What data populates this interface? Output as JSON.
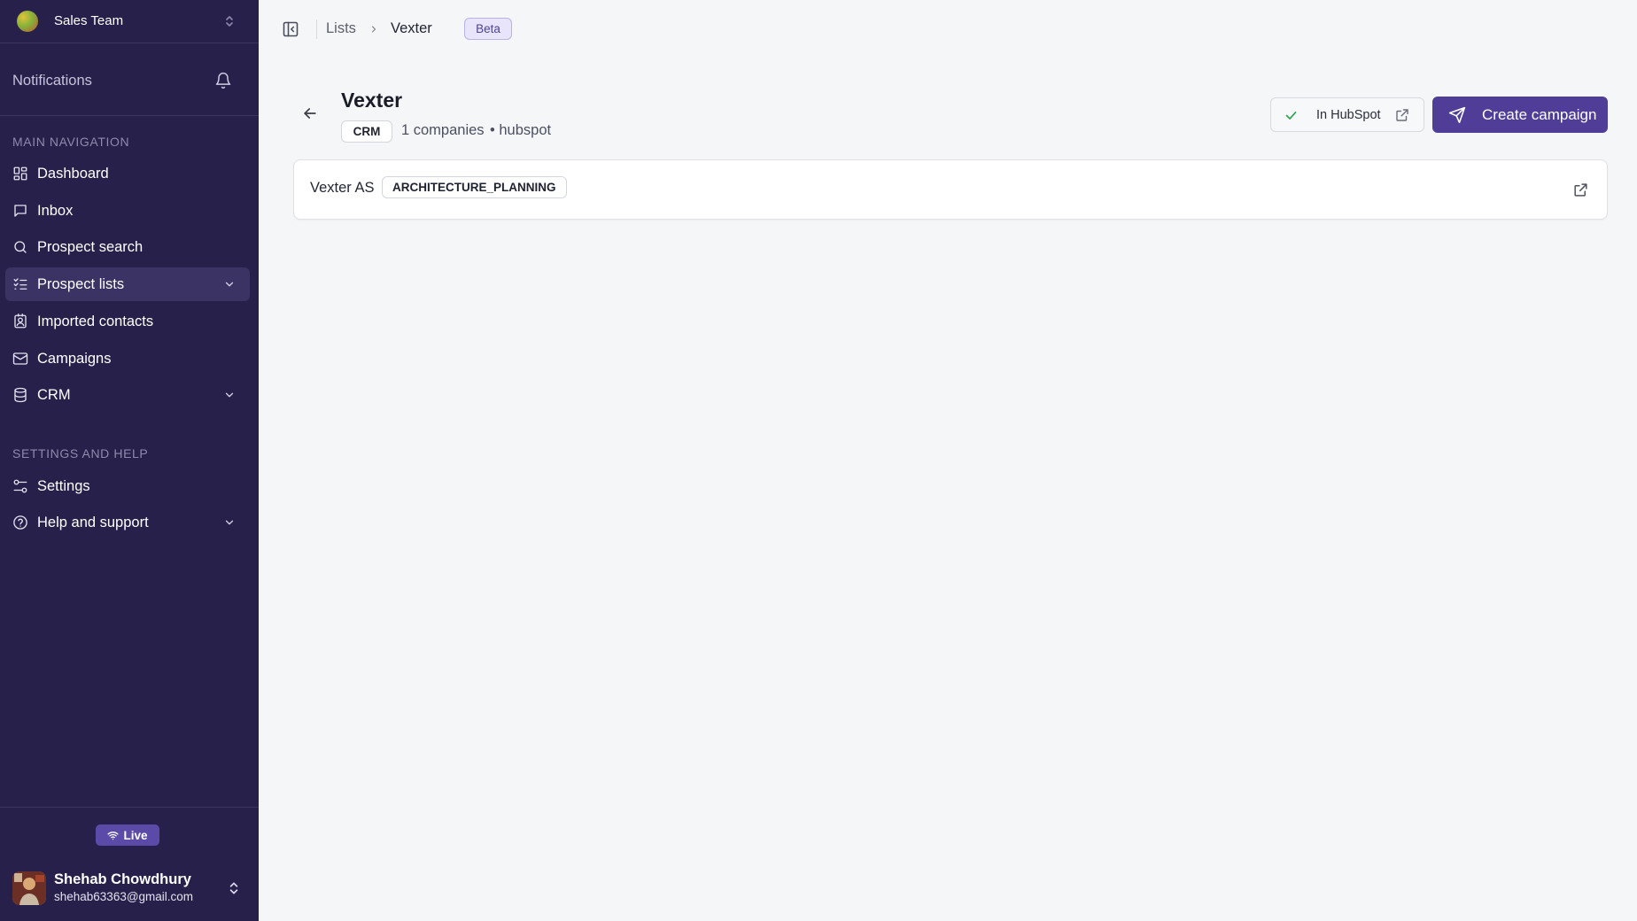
{
  "sidebar": {
    "team_name": "Sales Team",
    "notifications_label": "Notifications",
    "main_nav_title": "MAIN NAVIGATION",
    "main_nav": [
      {
        "label": "Dashboard",
        "icon": "dashboard-icon"
      },
      {
        "label": "Inbox",
        "icon": "inbox-icon"
      },
      {
        "label": "Prospect search",
        "icon": "search-icon"
      },
      {
        "label": "Prospect lists",
        "icon": "list-check-icon",
        "active": true,
        "expandable": true
      },
      {
        "label": "Imported contacts",
        "icon": "contact-icon"
      },
      {
        "label": "Campaigns",
        "icon": "mail-icon"
      },
      {
        "label": "CRM",
        "icon": "database-icon",
        "expandable": true
      }
    ],
    "settings_title": "SETTINGS AND HELP",
    "settings_nav": [
      {
        "label": "Settings",
        "icon": "settings-sliders-icon"
      },
      {
        "label": "Help and support",
        "icon": "help-icon",
        "expandable": true
      }
    ],
    "live_label": "Live",
    "user": {
      "name": "Shehab Chowdhury",
      "email": "shehab63363@gmail.com"
    }
  },
  "topbar": {
    "breadcrumb": [
      "Lists",
      "Vexter"
    ],
    "badge": "Beta"
  },
  "header": {
    "title": "Vexter",
    "tag": "CRM",
    "companies": "1 companies",
    "source": "• hubspot",
    "hubspot_button": "In HubSpot",
    "campaign_button": "Create campaign"
  },
  "companies": [
    {
      "name": "Vexter AS",
      "industry": "ARCHITECTURE_PLANNING"
    }
  ],
  "colors": {
    "sidebar_bg": "#26204a",
    "accent": "#4f3d98",
    "page_bg": "#f5f6f8",
    "success": "#2ea44f"
  }
}
